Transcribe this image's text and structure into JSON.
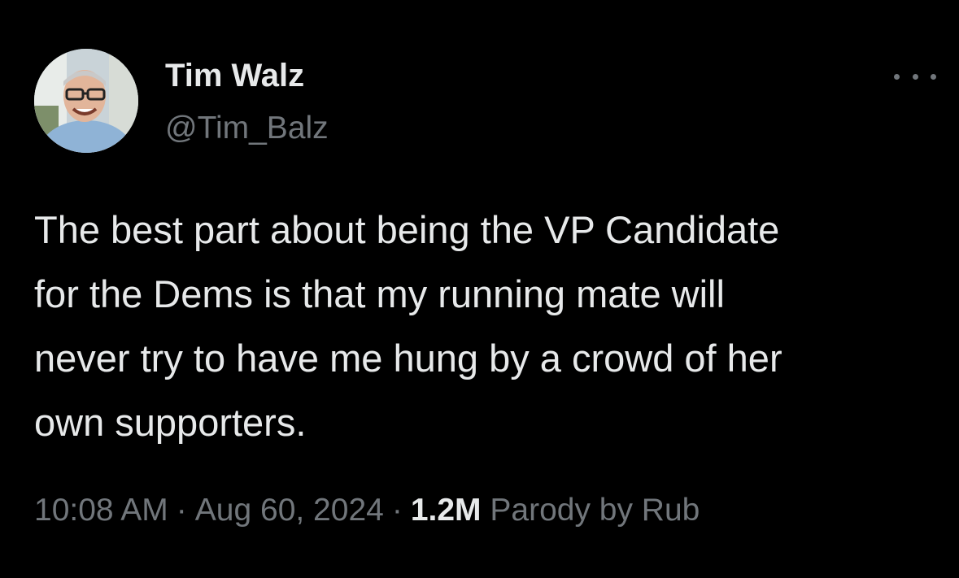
{
  "tweet": {
    "author": {
      "display_name": "Tim Walz",
      "handle": "@Tim_Balz",
      "avatar_icon": "profile-photo"
    },
    "more_icon": "more-horizontal-icon",
    "body_lines": [
      "The best part about being the VP Candidate",
      "for the Dems is that my running mate will",
      "never try to have me hung by a crowd of her",
      "own supporters."
    ],
    "meta": {
      "time": "10:08 AM",
      "separator": "·",
      "date": "Aug 60, 2024",
      "views": "1.2M",
      "views_suffix": "Parody by Rub"
    }
  },
  "colors": {
    "background": "#000000",
    "primary_text": "#e7e9ea",
    "secondary_text": "#71767b"
  }
}
